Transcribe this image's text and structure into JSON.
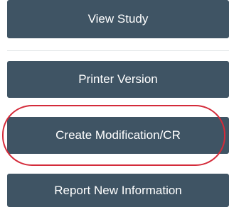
{
  "actions": {
    "view_study": "View Study",
    "printer_version": "Printer Version",
    "create_modification": "Create Modification/CR",
    "report_new_information": "Report New Information"
  },
  "colors": {
    "button_bg": "#3f5464",
    "button_text": "#ffffff",
    "highlight": "#d42b3a"
  }
}
